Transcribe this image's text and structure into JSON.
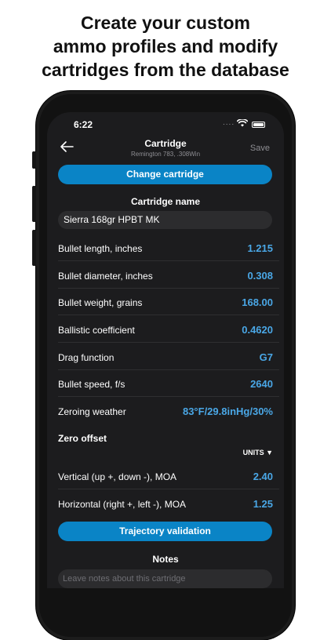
{
  "headline": {
    "line1": "Create your custom",
    "line2": "ammo profiles and modify",
    "line3": "cartridges from the database"
  },
  "status": {
    "time": "6:22",
    "signal": "...."
  },
  "nav": {
    "title": "Cartridge",
    "subtitle": "Remington 783, .308Win",
    "save_label": "Save"
  },
  "change_button": "Change cartridge",
  "cartridge_name": {
    "heading": "Cartridge name",
    "value": "Sierra 168gr HPBT MK"
  },
  "rows": [
    {
      "label": "Bullet length, inches",
      "value": "1.215"
    },
    {
      "label": "Bullet diameter, inches",
      "value": "0.308"
    },
    {
      "label": "Bullet weight, grains",
      "value": "168.00"
    },
    {
      "label": "Ballistic coefficient",
      "value": "0.4620"
    },
    {
      "label": "Drag function",
      "value": "G7"
    },
    {
      "label": "Bullet speed, f/s",
      "value": "2640"
    },
    {
      "label": "Zeroing weather",
      "value": "83°F/29.8inHg/30%"
    }
  ],
  "zero_offset": {
    "title": "Zero offset",
    "units_label": "UNITS ▼",
    "rows": [
      {
        "label": "Vertical (up +, down -), MOA",
        "value": "2.40"
      },
      {
        "label": "Horizontal (right +, left -), MOA",
        "value": "1.25"
      }
    ]
  },
  "trajectory_button": "Trajectory validation",
  "notes": {
    "heading": "Notes",
    "placeholder": "Leave notes about this cartridge"
  },
  "colors": {
    "accent": "#0a84c6",
    "value_text": "#4aa7e6",
    "screen_bg": "#1c1c1e"
  }
}
